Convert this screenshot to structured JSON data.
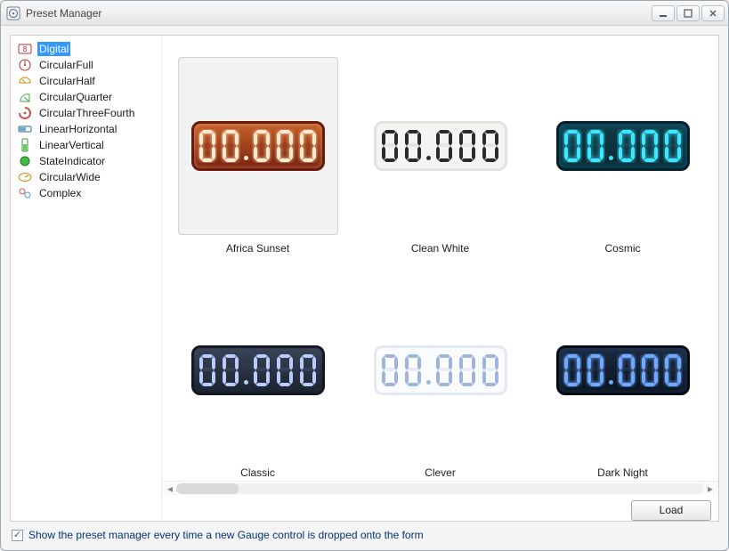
{
  "window": {
    "title": "Preset Manager"
  },
  "sidebar": {
    "items": [
      {
        "label": "Digital",
        "icon": "digital",
        "selected": true
      },
      {
        "label": "CircularFull",
        "icon": "circ-full"
      },
      {
        "label": "CircularHalf",
        "icon": "circ-half"
      },
      {
        "label": "CircularQuarter",
        "icon": "circ-quarter"
      },
      {
        "label": "CircularThreeFourth",
        "icon": "circ-threefourth"
      },
      {
        "label": "LinearHorizontal",
        "icon": "linear-h"
      },
      {
        "label": "LinearVertical",
        "icon": "linear-v"
      },
      {
        "label": "StateIndicator",
        "icon": "state"
      },
      {
        "label": "CircularWide",
        "icon": "circ-wide"
      },
      {
        "label": "Complex",
        "icon": "complex"
      }
    ]
  },
  "gallery": {
    "presets": [
      {
        "label": "Africa Sunset",
        "style": "g-africa",
        "selected": true
      },
      {
        "label": "Clean White",
        "style": "g-clean"
      },
      {
        "label": "Cosmic",
        "style": "g-cosmic"
      },
      {
        "label": "Classic",
        "style": "g-classic"
      },
      {
        "label": "Clever",
        "style": "g-clever"
      },
      {
        "label": "Dark Night",
        "style": "g-dark"
      }
    ],
    "digit_pattern": "00.000"
  },
  "buttons": {
    "load": "Load"
  },
  "footer": {
    "checkbox_checked": true,
    "label": "Show the preset manager every time a new Gauge control is dropped onto the form"
  }
}
